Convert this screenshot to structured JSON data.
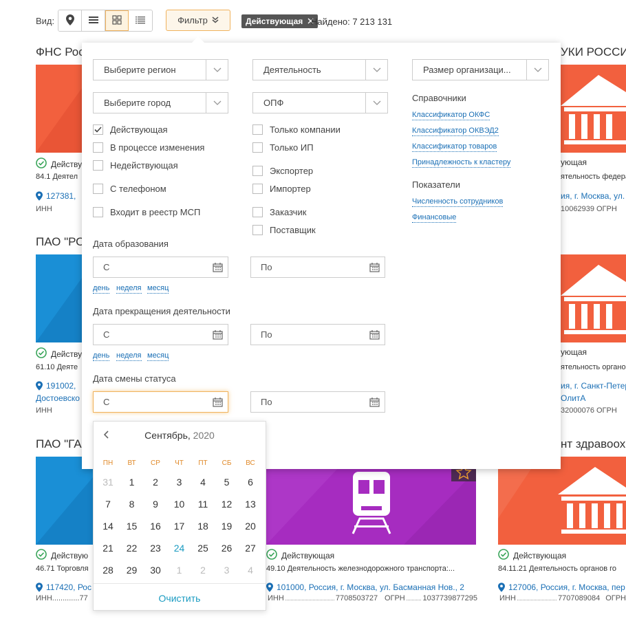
{
  "toolbar": {
    "view_label": "Вид:",
    "view_buttons": [
      {
        "icon": "map-pin-icon",
        "active": false
      },
      {
        "icon": "list-icon",
        "active": false
      },
      {
        "icon": "grid-icon",
        "active": true
      },
      {
        "icon": "compact-list-icon",
        "active": false
      }
    ],
    "filter_label": "Фильтр",
    "active_chip": "Действующая",
    "found_text": "Найдено: 7 213 131"
  },
  "cards": [
    {
      "title": "ФНС Рос",
      "status": "Действу",
      "activity": "84.1 Деятел",
      "address": "127381,",
      "inn": "ИНН"
    },
    {
      "title": "УКИ РОССИ",
      "status": "ующая",
      "activity": "ятельность федераль",
      "address": "ия, г. Москва, ул.",
      "inn": "10062939     ОГРН"
    },
    {
      "title": "ПАО \"РОС",
      "status": "Действу",
      "activity": "61.10 Деяте",
      "address": "191002,",
      "address2": "Достоевско",
      "inn": "ИНН"
    },
    {
      "title": "",
      "status": "ующая",
      "activity": "ятельность органов го",
      "address": "ия, г. Санкт-Петер",
      "address2": "ОлитА",
      "inn": "32000076     ОГРН"
    },
    {
      "title": "ПАО \"ГАЗ",
      "status": "Действую",
      "activity": "46.71 Торговля",
      "address": "117420, Рос",
      "inn": "ИНН.............77"
    },
    {
      "title": "",
      "status": "Действующая",
      "activity": "49.10 Деятельность железнодорожного транспорта:...",
      "address": "101000, Россия, г. Москва, ул. Басманная Нов., 2",
      "inn": "ИНН",
      "inn_value": "7708503727",
      "ogrn": "ОГРН",
      "ogrn_value": "1037739877295"
    },
    {
      "title": "нт здравоохр",
      "status": "Действующая",
      "activity": "84.11.21 Деятельность органов го",
      "address": "127006, Россия, г. Москва, пер",
      "inn": "ИНН",
      "inn_value": "7707089084",
      "ogrn": "ОГРН"
    }
  ],
  "filter": {
    "region_placeholder": "Выберите регион",
    "activity_placeholder": "Деятельность",
    "size_placeholder": "Размер организаци...",
    "city_placeholder": "Выберите город",
    "opf_placeholder": "ОПФ",
    "checkboxes_col1": [
      {
        "label": "Действующая",
        "checked": true
      },
      {
        "label": "В процессе изменения",
        "checked": false
      },
      {
        "label": "Недействующая",
        "checked": false
      },
      {
        "label": "С телефоном",
        "checked": false
      },
      {
        "label": "Входит в реестр МСП",
        "checked": false
      }
    ],
    "checkboxes_col2": [
      {
        "label": "Только компании",
        "checked": false
      },
      {
        "label": "Только ИП",
        "checked": false
      },
      {
        "label": "Экспортер",
        "checked": false
      },
      {
        "label": "Импортер",
        "checked": false
      },
      {
        "label": "Заказчик",
        "checked": false
      },
      {
        "label": "Поставщик",
        "checked": false
      }
    ],
    "references_title": "Справочники",
    "references": [
      "Классификатор ОКФС",
      "Классификатор ОКВЭД2",
      "Классификатор товаров",
      "Принадлежность к кластеру"
    ],
    "indicators_title": "Показатели",
    "indicators": [
      "Численность сотрудников",
      "Финансовые"
    ],
    "date_sections": [
      {
        "label": "Дата образования",
        "from": "С",
        "to": "По",
        "quick": [
          "день",
          "неделя",
          "месяц"
        ]
      },
      {
        "label": "Дата прекращения деятельности",
        "from": "С",
        "to": "По",
        "quick": [
          "день",
          "неделя",
          "месяц"
        ]
      },
      {
        "label": "Дата смены статуса",
        "from": "С",
        "to": "По"
      }
    ]
  },
  "calendar": {
    "month": "Сентябрь,",
    "year": "2020",
    "weekdays": [
      "ПН",
      "ВТ",
      "СР",
      "ЧТ",
      "ПТ",
      "СБ",
      "ВС"
    ],
    "weeks": [
      [
        "31",
        "1",
        "2",
        "3",
        "4",
        "5",
        "6"
      ],
      [
        "7",
        "8",
        "9",
        "10",
        "11",
        "12",
        "13"
      ],
      [
        "14",
        "15",
        "16",
        "17",
        "18",
        "19",
        "20"
      ],
      [
        "21",
        "22",
        "23",
        "24",
        "25",
        "26",
        "27"
      ],
      [
        "28",
        "29",
        "30",
        "1",
        "2",
        "3",
        "4"
      ]
    ],
    "today": "24",
    "clear_label": "Очистить"
  },
  "colors": {
    "accent": "#f0b25c",
    "link": "#1a6fb5",
    "red_card": "#f2603e",
    "blue_card": "#1a8fd6",
    "purple_card": "#a62cc0",
    "green_check": "#3aa55a"
  }
}
